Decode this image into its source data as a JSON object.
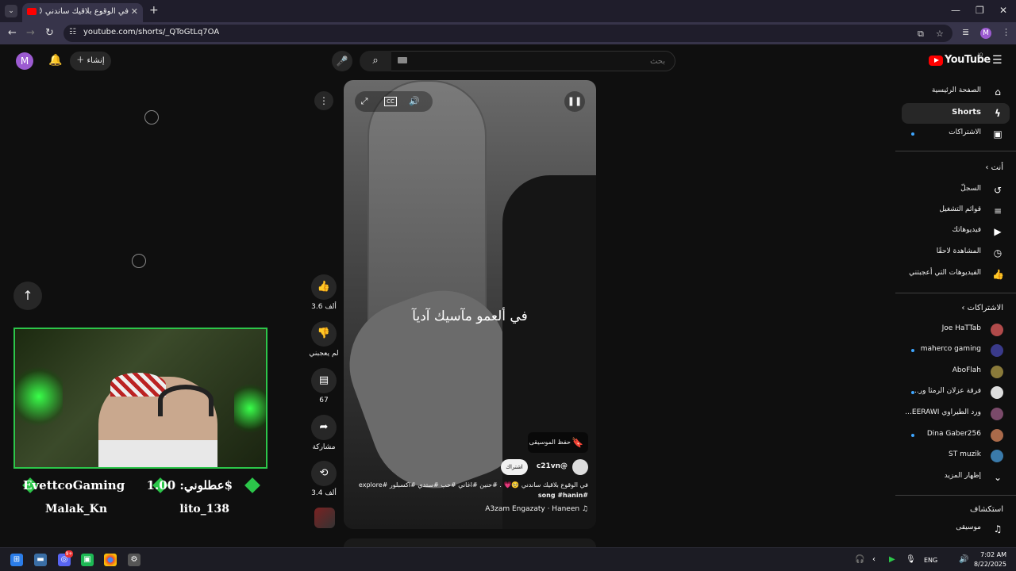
{
  "browser": {
    "tab_title": "في الوقوع بلاقيك ساندني 😢",
    "tab_close": "✕",
    "new_tab": "+",
    "url": "youtube.com/shorts/_QToGtLq7OA",
    "window_controls": [
      "—",
      "❐",
      "✕"
    ]
  },
  "masthead": {
    "avatar_letter": "M",
    "create_label": "إنشاء",
    "search_placeholder": "بحث",
    "logo_text": "YouTube",
    "logo_country": "JO"
  },
  "sidebar": {
    "main": [
      {
        "label": "الصفحة الرئيسية",
        "icon": "home-icon",
        "glyph": "⌂",
        "active": false,
        "dot": false
      },
      {
        "label": "Shorts",
        "icon": "shorts-icon",
        "glyph": "ϟ",
        "active": true,
        "dot": false
      },
      {
        "label": "الاشتراكات",
        "icon": "subscriptions-icon",
        "glyph": "▣",
        "active": false,
        "dot": true
      }
    ],
    "you_header": "أنت",
    "you": [
      {
        "label": "السجلّ",
        "icon": "history-icon",
        "glyph": "↺"
      },
      {
        "label": "قوائم التشغيل",
        "icon": "playlists-icon",
        "glyph": "≡"
      },
      {
        "label": "فيديوهاتك",
        "icon": "your-videos-icon",
        "glyph": "▶"
      },
      {
        "label": "المشاهدة لاحقًا",
        "icon": "watch-later-icon",
        "glyph": "◷"
      },
      {
        "label": "الفيديوهات التي أعجبتني",
        "icon": "liked-videos-icon",
        "glyph": "👍"
      }
    ],
    "subs_header": "الاشتراكات",
    "subs": [
      {
        "label": "Joe HaTTab",
        "dot": false,
        "color": "#b04a4a"
      },
      {
        "label": "maherco gaming",
        "dot": true,
        "color": "#3a3a8a"
      },
      {
        "label": "AboFlah",
        "dot": false,
        "color": "#8a7a3a"
      },
      {
        "label": "فرقة عزلان الرمثا ور...",
        "dot": true,
        "color": "#dddddd"
      },
      {
        "label": "ورد الطيراوي EERAWI...",
        "dot": false,
        "color": "#7a4a6a"
      },
      {
        "label": "Dina Gaber256",
        "dot": true,
        "color": "#aa6a4a"
      },
      {
        "label": "ST muzik",
        "dot": false,
        "color": "#3a7aaa"
      }
    ],
    "show_more": "إظهار المزيد",
    "explore_header": "استكشاف",
    "explore": [
      {
        "label": "موسيقى",
        "icon": "music-icon",
        "glyph": "♫"
      }
    ]
  },
  "overlay": {
    "name_left": "EvettcoGaming",
    "donate": "عطلوني: 1.00$",
    "name_bottom_left": "Malak_Kn",
    "name_bottom_right": "lito_138"
  },
  "actions": {
    "likes": "3.6 ألف",
    "dislike": "لم يعجبني",
    "comments": "67",
    "share": "مشاركة",
    "remix": "3.4 ألف"
  },
  "video": {
    "caption": "في ألعمو مآسيك آديآ",
    "save_music": "حفظ الموسيقى",
    "channel": "@c21vn",
    "subscribe": "اشتراك",
    "description_1": "في الوقوع بلاقيك ساندني 🥺💗 . #حنين #اغاني #حب #ستدي #اكسبلور #explore",
    "description_2": "#song #hanin",
    "music": "A3zam Engazaty · Haneen ♫"
  },
  "taskbar": {
    "lang": "ENG",
    "time": "7:02 AM",
    "date": "8/22/2025",
    "discord_badge": "9+"
  }
}
